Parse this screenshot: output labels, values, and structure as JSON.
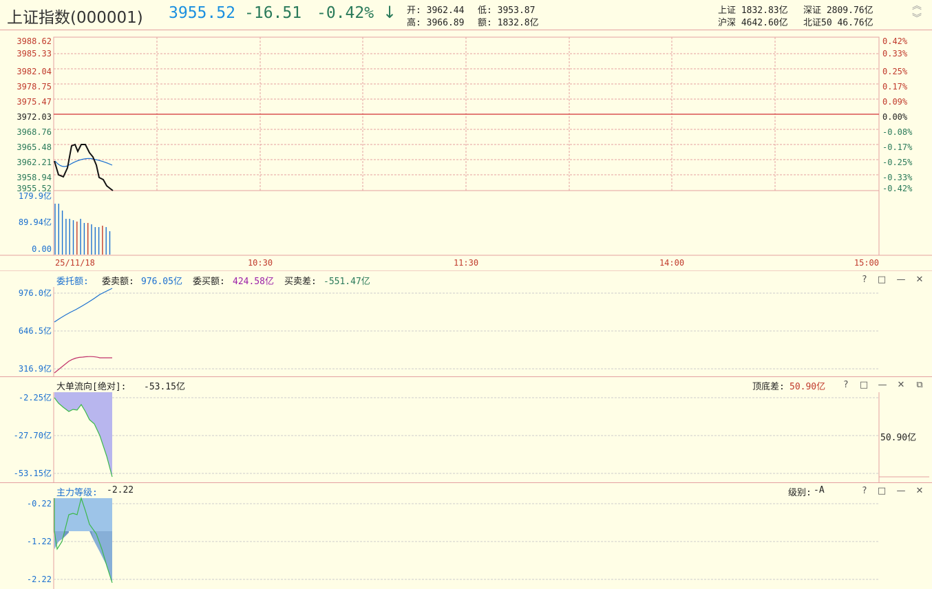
{
  "header": {
    "index_name": "上证指数(000001)",
    "price": "3955.52",
    "change": "-16.51",
    "change_pct": "-0.42%",
    "arrow": "↓",
    "open": "开: 3962.44",
    "low": "低: 3953.87",
    "high": "高: 3966.89",
    "amount": "额: 1832.8亿",
    "sh_label": "上证 1832.83亿",
    "sz_label": "深证 2809.76亿",
    "hs_label": "沪深 4642.60亿",
    "bz50_label": "北证50 46.76亿"
  },
  "price_chart": {
    "left_axis": [
      "3988.62",
      "3985.33",
      "3982.04",
      "3978.75",
      "3975.47",
      "3972.03",
      "3968.76",
      "3965.48",
      "3962.21",
      "3958.94",
      "3955.52"
    ],
    "right_axis": [
      "0.42%",
      "0.33%",
      "0.25%",
      "0.17%",
      "0.09%",
      "0.00%",
      "-0.08%",
      "-0.17%",
      "-0.25%",
      "-0.33%",
      "-0.42%"
    ],
    "volume_axis": [
      "179.9亿",
      "89.94亿",
      "0.00"
    ],
    "time_labels": [
      "25/11/18",
      "10:30",
      "11:30",
      "14:00",
      "15:00"
    ]
  },
  "panel_entrust": {
    "title": "委托额:",
    "sell_label": "委卖额:",
    "sell_value": "976.05亿",
    "buy_label": "委买额:",
    "buy_value": "424.58亿",
    "diff_label": "买卖差:",
    "diff_value": "-551.47亿",
    "axis": [
      "976.0亿",
      "646.5亿",
      "316.9亿"
    ]
  },
  "panel_bigorder": {
    "title": "大单流向[绝对]:",
    "value": "-53.15亿",
    "top_bottom_label": "顶底差:",
    "top_bottom_value": "50.90亿",
    "axis": [
      "-2.25亿",
      "-27.70亿",
      "-53.15亿"
    ],
    "right_value": "50.90亿"
  },
  "panel_main": {
    "title": "主力等级:",
    "value": "-2.22",
    "level_label": "级别:",
    "level_value": "-A",
    "axis": [
      "-0.22",
      "-1.22",
      "-2.22"
    ]
  },
  "controls": {
    "help": "?",
    "restore": "□",
    "minimize": "—",
    "close": "✕",
    "popout": "⧉"
  },
  "colors": {
    "background": "#fffee6",
    "grid_red": "#e4a0a0",
    "up_red": "#c0392b",
    "down_green": "#2a7a5a",
    "blue": "#1a6fd0",
    "purple": "#9b1fa8",
    "area_purple": "#b8b6ee",
    "area_blue": "#8fbce6"
  }
}
